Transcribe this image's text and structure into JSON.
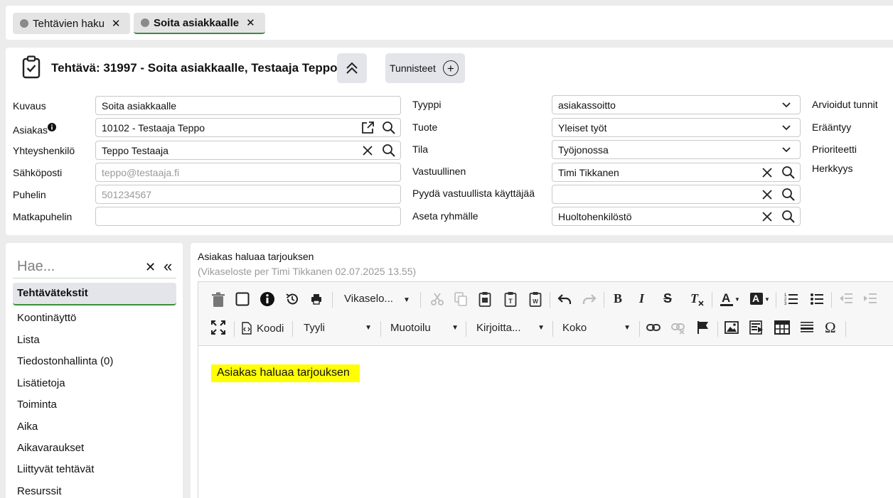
{
  "tabs": [
    {
      "label": "Tehtävien haku",
      "close": "✕"
    },
    {
      "label": "Soita asiakkaalle",
      "close": "✕"
    }
  ],
  "header": {
    "title": "Tehtävä: 31997 - Soita asiakkaalle, Testaaja Teppo",
    "tags_label": "Tunnisteet",
    "tags_plus": "+"
  },
  "form_left": {
    "kuvaus": {
      "label": "Kuvaus",
      "value": "Soita asiakkaalle"
    },
    "asiakas": {
      "label": "Asiakas",
      "value": "10102 - Testaaja Teppo"
    },
    "yhteyshenkilo": {
      "label": "Yhteyshenkilö",
      "value": "Teppo Testaaja"
    },
    "sahkoposti": {
      "label": "Sähköposti",
      "placeholder": "teppo@testaaja.fi"
    },
    "puhelin": {
      "label": "Puhelin",
      "placeholder": "501234567"
    },
    "matkapuhelin": {
      "label": "Matkapuhelin",
      "value": ""
    }
  },
  "form_mid": {
    "tyyppi": {
      "label": "Tyyppi",
      "value": "asiakassoitto"
    },
    "tuote": {
      "label": "Tuote",
      "value": "Yleiset työt"
    },
    "tila": {
      "label": "Tila",
      "value": "Työjonossa"
    },
    "vastuullinen": {
      "label": "Vastuullinen",
      "value": "Timi Tikkanen"
    },
    "pyyda": {
      "label": "Pyydä vastuullista käyttäjää",
      "value": ""
    },
    "ryhmalle": {
      "label": "Aseta ryhmälle",
      "value": "Huoltohenkilöstö"
    }
  },
  "form_right": {
    "arvioidut": "Arvioidut tunnit",
    "eraantyy": "Erääntyy",
    "prioriteetti": "Prioriteetti",
    "herkkyys": "Herkkyys"
  },
  "sidebar": {
    "search_placeholder": "Hae...",
    "clear": "✕",
    "collapse": "«",
    "items": [
      {
        "label": "Tehtävätekstit"
      },
      {
        "label": "Koontinäyttö"
      },
      {
        "label": "Lista"
      },
      {
        "label": "Tiedostonhallinta (0)"
      },
      {
        "label": "Lisätietoja"
      },
      {
        "label": "Toiminta"
      },
      {
        "label": "Aika"
      },
      {
        "label": "Aikavaraukset"
      },
      {
        "label": "Liittyvät tehtävät"
      },
      {
        "label": "Resurssit"
      }
    ]
  },
  "editor": {
    "title": "Asiakas haluaa tarjouksen",
    "subtitle": "(Vikaseloste per Timi Tikkanen 02.07.2025 13.55)",
    "dd_vikaselo": "Vikaselo...",
    "koodi": "Koodi",
    "dd_tyyli": "Tyyli",
    "dd_muotoilu": "Muotoilu",
    "dd_kirjoitta": "Kirjoitta...",
    "dd_koko": "Koko",
    "bold": "B",
    "italic": "I",
    "strike": "S",
    "omega": "Ω",
    "content": "Asiakas haluaa tarjouksen",
    "highlight_color": "#ffff00"
  }
}
